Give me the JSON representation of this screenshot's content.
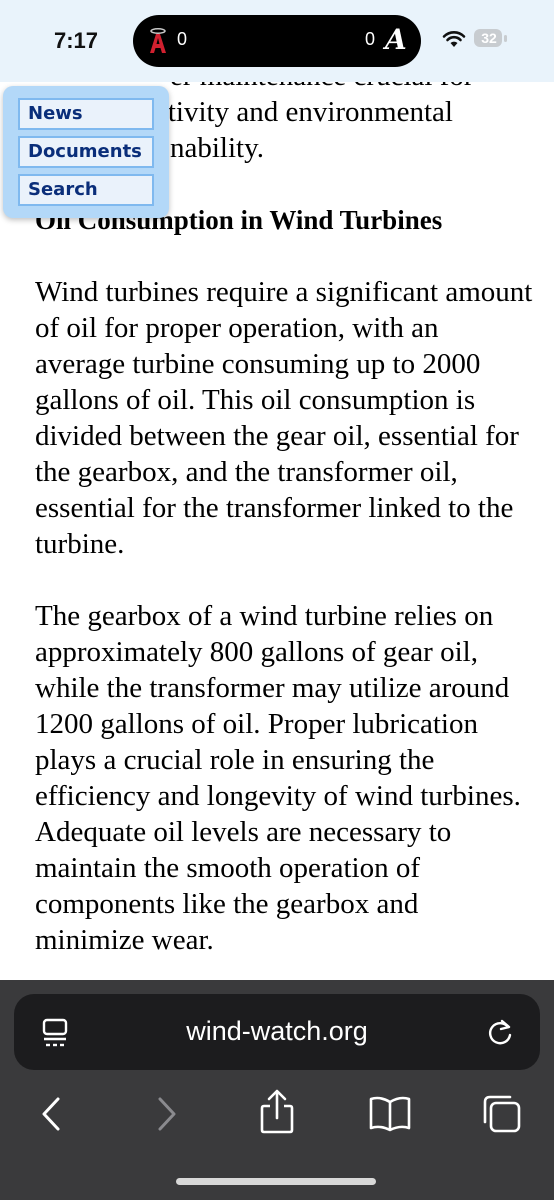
{
  "status_bar": {
    "time": "7:17",
    "live_activity": {
      "team_left_score": "0",
      "team_right_score": "0",
      "team_left_icon": "angels-logo-icon",
      "team_right_icon": "braves-logo-icon"
    },
    "battery_level": "32"
  },
  "article": {
    "partial_top_line": "er maintenance crucial for",
    "para1_line2_end": "ctivity and environmental",
    "para1_line3_end": "nability.",
    "heading": "Oil Consumption in Wind Turbines",
    "paragraph2": "Wind turbines require a significant amount of oil for proper operation, with an average turbine consuming up to 2000 gallons of oil. This oil consumption is divided between the gear oil, essential for the gearbox, and the transformer oil, essential for the transformer linked to the turbine.",
    "paragraph3": "The gearbox of a wind turbine relies on approximately 800 gallons of gear oil, while the transformer may utilize around 1200 gallons of oil. Proper lubrication plays a crucial role in ensuring the efficiency and longevity of wind turbines. Adequate oil levels are necessary to maintain the smooth operation of components like the gearbox and minimize wear."
  },
  "nav_menu": {
    "items": [
      "News",
      "Documents",
      "Search"
    ]
  },
  "browser": {
    "url": "wind-watch.org"
  },
  "colors": {
    "nav_bg": "#b3d8f8",
    "nav_item_text": "#0a2e7a",
    "toolbar_bg": "#3a3a3c",
    "url_bar_bg": "#1c1c1e"
  }
}
